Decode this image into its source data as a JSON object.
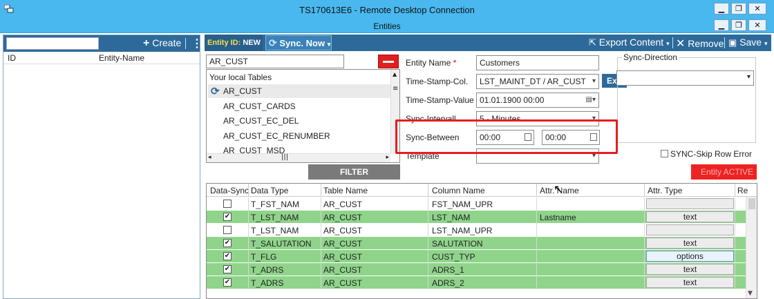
{
  "window": {
    "title": "TS170613E6 - Remote Desktop Connection",
    "subtitle": "Entities"
  },
  "left_panel": {
    "search_value": "",
    "create_label": "Create",
    "columns": [
      "ID",
      "Entity-Name"
    ]
  },
  "toolbar": {
    "entity_id_label": "Entity ID:",
    "entity_id_value": "NEW",
    "sync_now_label": "Sync. Now",
    "export_label": "Export Content",
    "remove_label": "Remove",
    "save_label": "Save"
  },
  "tables": {
    "selected_value": "AR_CUST",
    "list_header": "Your local Tables",
    "items": [
      "AR_CUST",
      "AR_CUST_CARDS",
      "AR_CUST_EC_DEL",
      "AR_CUST_EC_RENUMBER",
      "AR_CUST_MSD"
    ],
    "filter_label": "FILTER"
  },
  "form": {
    "entity_name_label": "Entity Name",
    "entity_name_required": "*",
    "entity_name_value": "Customers",
    "timestamp_col_label": "Time-Stamp-Col.",
    "timestamp_col_value": "LST_MAINT_DT / AR_CUST",
    "ext_label": "Ext.",
    "timestamp_value_label": "Time-Stamp-Value",
    "timestamp_value": "01.01.1900 00:00",
    "sync_interval_label": "Sync-Intervall",
    "sync_interval_value": "5 - Minutes",
    "sync_between_label": "Sync-Between",
    "sync_between_from": "00:00",
    "sync_between_to": "00:00",
    "template_label": "Template",
    "template_value": "",
    "sync_direction_label": "Sync-Direction",
    "sync_direction_value": "",
    "skip_row_error_label": "SYNC-Skip Row Error",
    "entity_active_label": "Entity ACTIVE"
  },
  "grid": {
    "columns": [
      "Data-Sync",
      "Data Type",
      "Table Name",
      "Column Name",
      "Attr. Name",
      "Attr. Type",
      "Re"
    ],
    "rows": [
      {
        "checked": "",
        "data_type": "T_FST_NAM",
        "table": "AR_CUST",
        "column": "FST_NAM_UPR",
        "attr_name": "",
        "attr_type": ""
      },
      {
        "checked": "✔",
        "data_type": "T_LST_NAM",
        "table": "AR_CUST",
        "column": "LST_NAM",
        "attr_name": "Lastname",
        "attr_type": "text"
      },
      {
        "checked": "",
        "data_type": "T_LST_NAM",
        "table": "AR_CUST",
        "column": "LST_NAM_UPR",
        "attr_name": "",
        "attr_type": ""
      },
      {
        "checked": "✔",
        "data_type": "T_SALUTATION",
        "table": "AR_CUST",
        "column": "SALUTATION",
        "attr_name": "",
        "attr_type": "text"
      },
      {
        "checked": "✔",
        "data_type": "T_FLG",
        "table": "AR_CUST",
        "column": "CUST_TYP",
        "attr_name": "",
        "attr_type": "options"
      },
      {
        "checked": "✔",
        "data_type": "T_ADRS",
        "table": "AR_CUST",
        "column": "ADRS_1",
        "attr_name": "",
        "attr_type": "text"
      },
      {
        "checked": "✔",
        "data_type": "T_ADRS",
        "table": "AR_CUST",
        "column": "ADRS_2",
        "attr_name": "",
        "attr_type": "text"
      }
    ],
    "row_colors": {
      "checked": "#8fd48a",
      "unchecked": "#ffffff"
    }
  }
}
